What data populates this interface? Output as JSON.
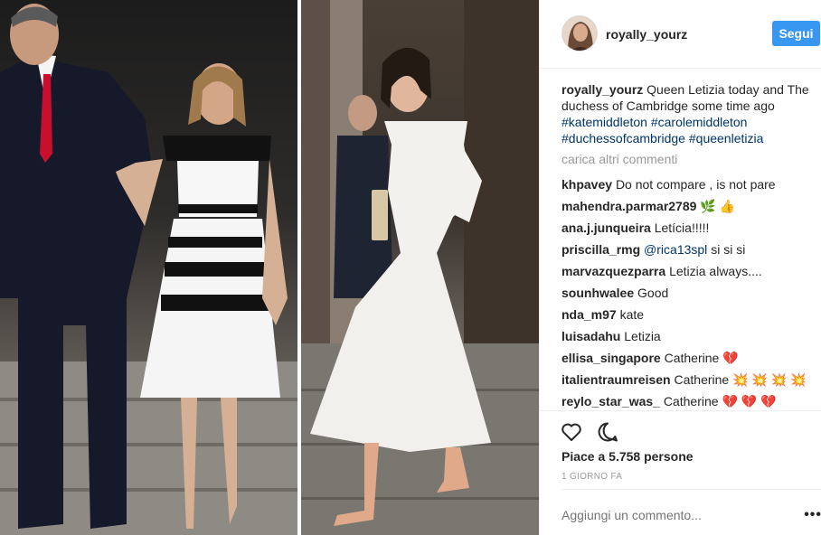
{
  "colors": {
    "accent": "#3897f0",
    "tag": "#003569",
    "muted": "#999999"
  },
  "header": {
    "username": "royally_yourz",
    "follow_label": "Segui"
  },
  "caption": {
    "user": "royally_yourz",
    "text": "Queen Letizia today and The duchess of Cambridge some time ago",
    "tags": [
      "#katemiddleton",
      "#carolemiddleton",
      "#duchessofcambridge",
      "#queenletizia"
    ]
  },
  "load_more": "carica altri commenti",
  "comments": [
    {
      "user": "khpavey",
      "text": "Do not compare , is not pare"
    },
    {
      "user": "mahendra.parmar2789",
      "text": "",
      "emoji": [
        "🌿",
        "👍"
      ]
    },
    {
      "user": "ana.j.junqueira",
      "text": "Letícia!!!!!"
    },
    {
      "user": "priscilla_rmg",
      "mention": "@rica13spl",
      "text": "si si si"
    },
    {
      "user": "marvazquezparra",
      "text": "Letizia always...."
    },
    {
      "user": "sounhwalee",
      "text": "Good"
    },
    {
      "user": "nda_m97",
      "text": "kate"
    },
    {
      "user": "luisadahu",
      "text": "Letizia"
    },
    {
      "user": "ellisa_singapore",
      "text": "Catherine",
      "emoji": [
        "💔"
      ]
    },
    {
      "user": "italientraumreisen",
      "text": "Catherine",
      "emoji": [
        "💥",
        "💥",
        "💥",
        "💥"
      ]
    },
    {
      "user": "reylo_star_was_",
      "text": "Catherine",
      "emoji": [
        "💔",
        "💔",
        "💔"
      ]
    }
  ],
  "actions": {
    "like_icon": "heart-icon",
    "comment_icon": "comment-icon",
    "likes_text": "Piace a 5.758 persone",
    "time_text": "1 GIORNO FA"
  },
  "comment_box": {
    "placeholder": "Aggiungi un commento...",
    "more_icon": "more-options-icon"
  }
}
